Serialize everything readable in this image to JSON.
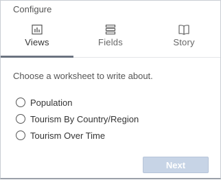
{
  "title": "Configure",
  "tabs": [
    {
      "label": "Views",
      "icon": "bar-chart-icon",
      "active": true
    },
    {
      "label": "Fields",
      "icon": "list-icon",
      "active": false
    },
    {
      "label": "Story",
      "icon": "book-icon",
      "active": false
    }
  ],
  "prompt": "Choose a worksheet to write about.",
  "worksheets": [
    {
      "label": "Population",
      "selected": false
    },
    {
      "label": "Tourism By Country/Region",
      "selected": false
    },
    {
      "label": "Tourism Over Time",
      "selected": false
    }
  ],
  "next_label": "Next",
  "next_enabled": false,
  "colors": {
    "next_disabled_bg": "#c7d4e6",
    "active_tab_indicator": "#6b7380"
  }
}
